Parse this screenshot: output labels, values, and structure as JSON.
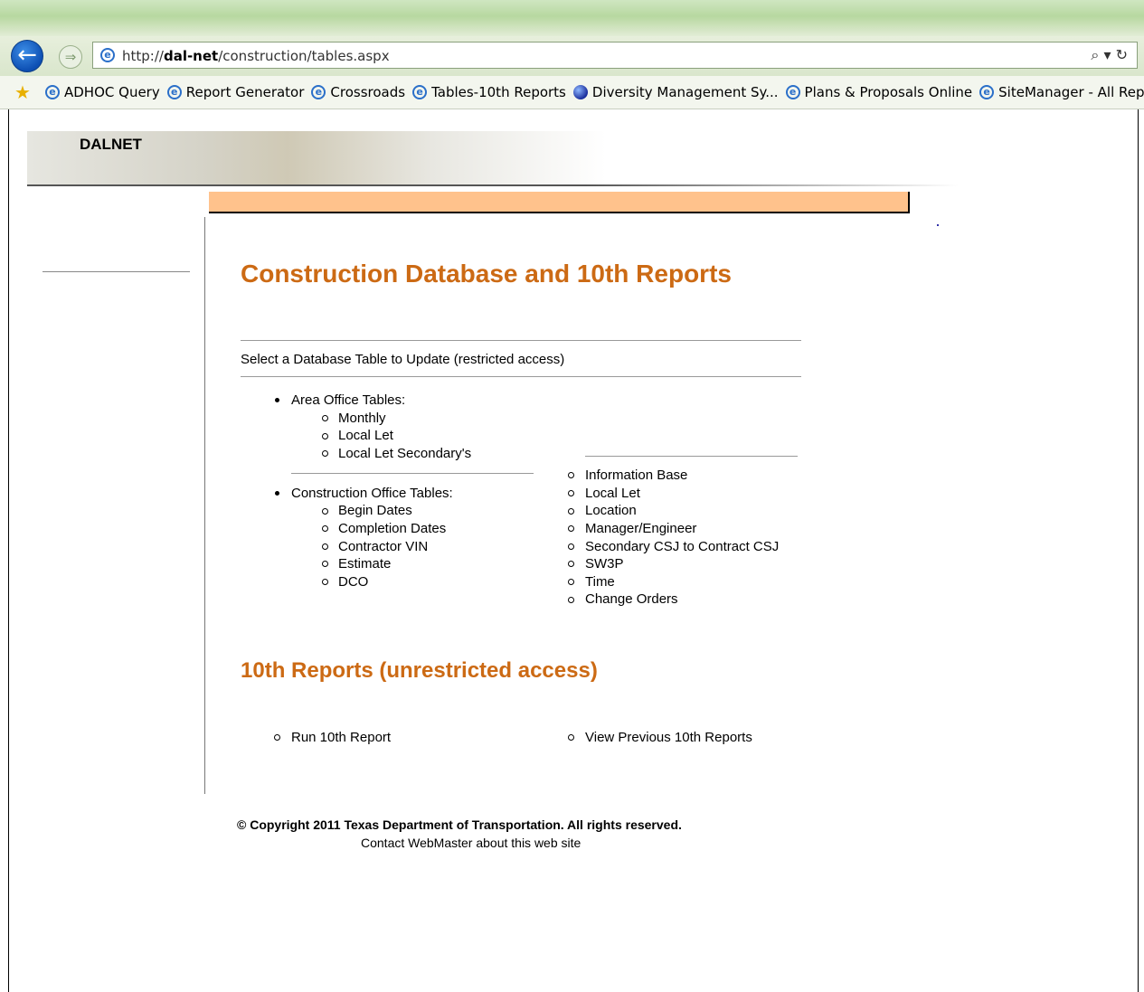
{
  "browser": {
    "url_prefix": "http://",
    "url_host": "dal-net",
    "url_path": "/construction/tables.aspx",
    "url_tools": "⌕ ▾ ↻",
    "favorites": [
      {
        "label": "ADHOC Query",
        "icon": "ie-page-icon"
      },
      {
        "label": "Report Generator",
        "icon": "ie-page-icon"
      },
      {
        "label": "Crossroads",
        "icon": "ie-page-icon"
      },
      {
        "label": "Tables-10th Reports",
        "icon": "ie-page-icon"
      },
      {
        "label": "Diversity Management Sy...",
        "icon": "globe-icon"
      },
      {
        "label": "Plans & Proposals Online",
        "icon": "ie-page-icon"
      },
      {
        "label": "SiteManager - All Reports",
        "icon": "ie-page-icon"
      }
    ]
  },
  "site": {
    "name": "DALNET"
  },
  "main": {
    "title": "Construction Database and 10th Reports",
    "select_label": "Select a Database Table to Update (restricted access)",
    "area_office": {
      "heading": "Area Office Tables:",
      "items": [
        "Monthly",
        "Local Let",
        "Local Let Secondary's"
      ]
    },
    "construction_office": {
      "heading": "Construction Office Tables:",
      "items_left": [
        "Begin Dates",
        "Completion Dates",
        "Contractor VIN",
        "Estimate",
        "DCO"
      ],
      "items_right": [
        "Information Base",
        "Local Let",
        "Location",
        "Manager/Engineer",
        "Secondary CSJ to Contract CSJ",
        "SW3P",
        "Time",
        "Change Orders"
      ]
    },
    "reports": {
      "heading": "10th Reports (unrestricted access)",
      "run_label": "Run 10th Report",
      "view_label": "View Previous 10th Reports"
    }
  },
  "footer": {
    "copyright": "© Copyright 2011 Texas Department of Transportation.  All rights reserved.",
    "contact": "Contact WebMaster about this web site"
  },
  "colors": {
    "heading": "#cc6a14",
    "orange_bar": "#ffc28c"
  }
}
